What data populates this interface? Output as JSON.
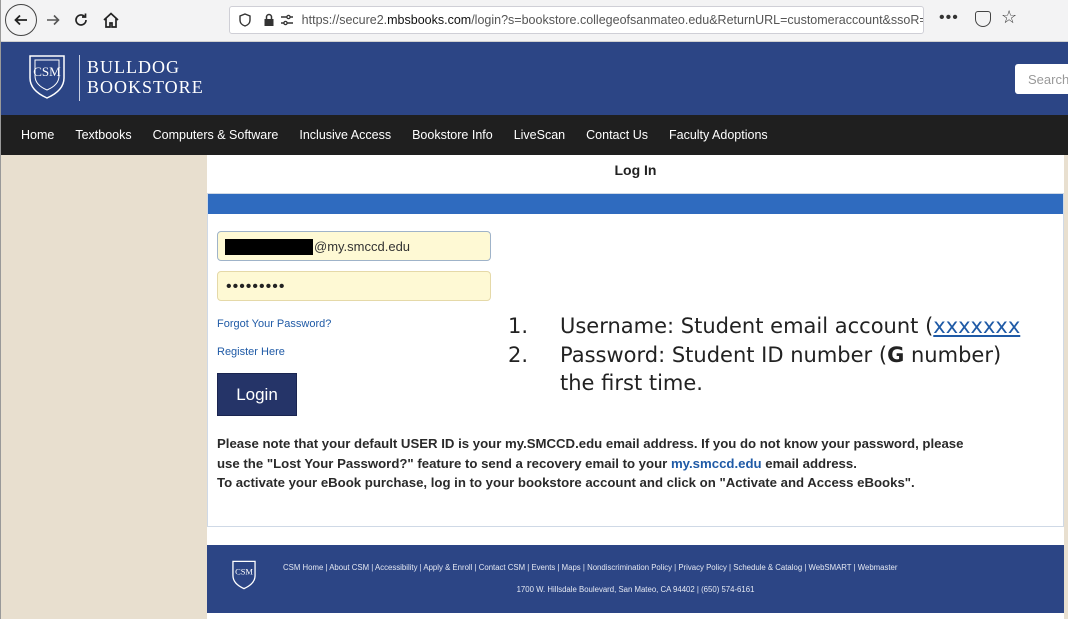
{
  "browser": {
    "url_prefix": "https://secure2.",
    "url_domain": "mbsbooks.com",
    "url_rest": "/login?s=bookstore.collegeofsanmateo.edu&ReturnURL=customeraccount&ssoR=",
    "menu_dots": "•••"
  },
  "header": {
    "logo_text": "CSM",
    "brand_line1": "BULLDOG",
    "brand_line2": "BOOKSTORE",
    "search_placeholder": "Search"
  },
  "nav": {
    "items": [
      "Home",
      "Textbooks",
      "Computers & Software",
      "Inclusive Access",
      "Bookstore Info",
      "LiveScan",
      "Contact Us",
      "Faculty Adoptions"
    ]
  },
  "page": {
    "title": "Log In"
  },
  "form": {
    "email_visible_value": "@my.smccd.edu",
    "password_mask": "•••••••••",
    "forgot_link": "Forgot Your Password?",
    "register_link": "Register Here",
    "login_button": "Login"
  },
  "instructions": {
    "item1_num": "1.",
    "item1_text": "Username: Student email account (",
    "item1_link": "xxxxxxx",
    "item2_num": "2.",
    "item2_text_a": "Password: Student ID number (",
    "item2_bold": "G",
    "item2_text_b": " number)",
    "item2_cont": "the first time."
  },
  "note": {
    "line1": "Please note that your default USER ID is your my.SMCCD.edu email address. If you do not know your password, please",
    "line2_a": "use the \"Lost Your Password?\" feature to send a recovery email to your ",
    "line2_link": "my.smccd.edu",
    "line2_b": " email address.",
    "line3": "To activate your eBook purchase, log in to your bookstore account and click on \"Activate and Access eBooks\"."
  },
  "footer": {
    "logo_text": "CSM",
    "links": "CSM Home | About CSM | Accessibility | Apply & Enroll | Contact CSM | Events | Maps | Nondiscrimination Policy | Privacy Policy | Schedule & Catalog | WebSMART | Webmaster",
    "address": "1700 W. Hillsdale Boulevard, San Mateo, CA 94402  |  (650) 574-6161"
  },
  "colors": {
    "header_blue": "#2c4585",
    "nav_black": "#1f1f1f",
    "panel_bar_blue": "#2f6bbf",
    "login_button": "#253468",
    "sidebar_beige": "#e8dfcf",
    "input_yellow": "#fef9d4",
    "link_blue": "#1f5aa6"
  }
}
